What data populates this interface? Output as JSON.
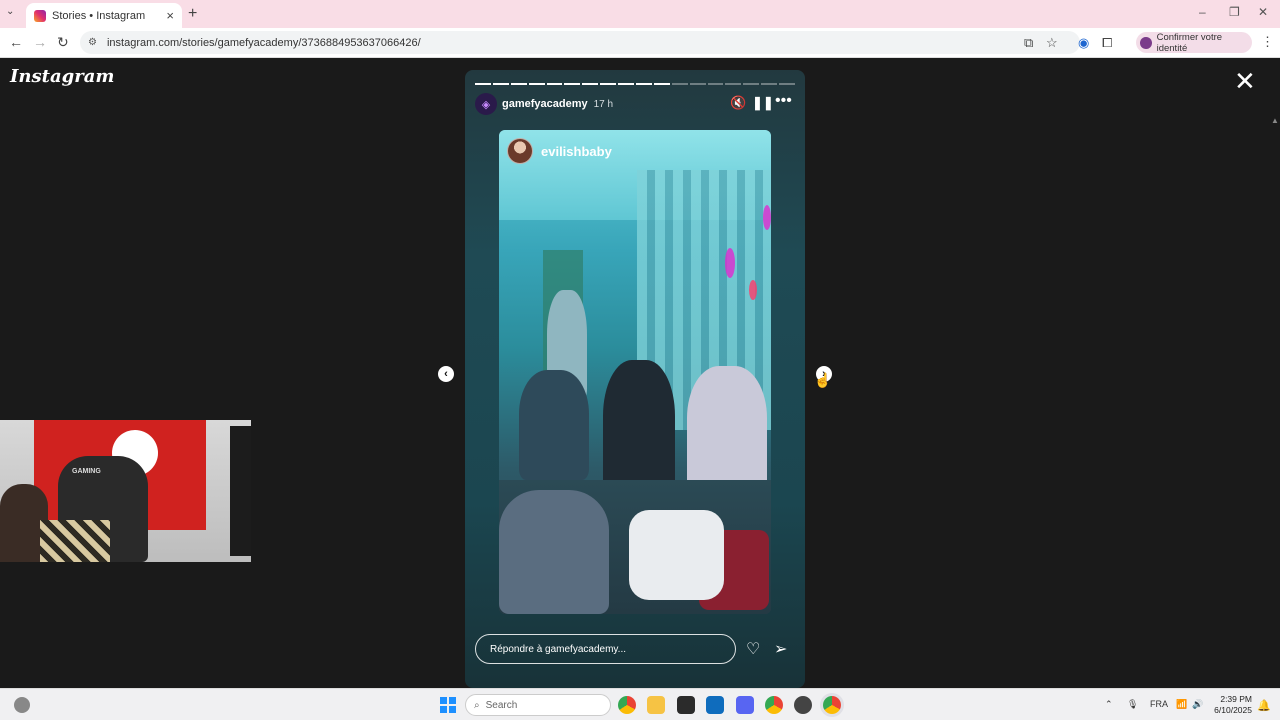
{
  "browser": {
    "tab_title": "Stories • Instagram",
    "url": "instagram.com/stories/gamefyacademy/3736884953637066426/",
    "profile_label": "Confirmer votre identité"
  },
  "instagram": {
    "logo": "Instagram",
    "story": {
      "segments_total": 18,
      "segments_done": 11,
      "username": "gamefyacademy",
      "time_ago": "17 h",
      "mention_username": "evilishbaby",
      "reply_placeholder": "Répondre à gamefyacademy..."
    }
  },
  "webcam": {
    "chair_brand": "GAMING"
  },
  "taskbar": {
    "search_placeholder": "Search",
    "language": "FRA",
    "time": "2:39 PM",
    "date": "6/10/2025"
  },
  "icons": {
    "mute": "speaker-muted-icon",
    "pause": "pause-icon",
    "more": "more-icon",
    "like": "heart-icon",
    "send": "send-icon",
    "close": "close-icon"
  }
}
